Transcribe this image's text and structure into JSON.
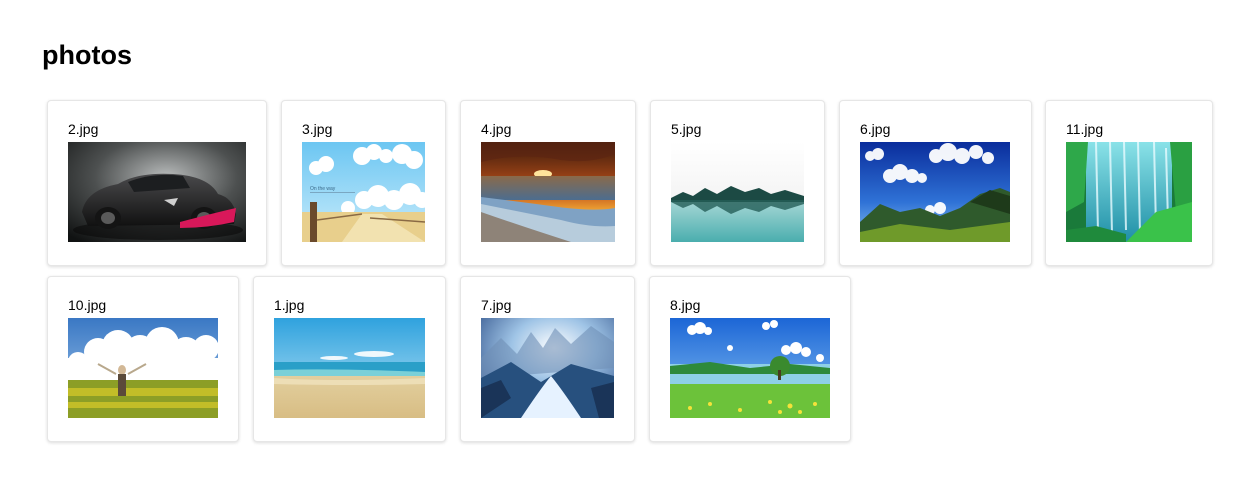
{
  "page": {
    "title": "photos"
  },
  "photos": [
    {
      "filename": "2.jpg",
      "subject": "black sports car"
    },
    {
      "filename": "3.jpg",
      "subject": "sky and wooden fence illustration",
      "caption_text": "On the way"
    },
    {
      "filename": "4.jpg",
      "subject": "sunset over beach"
    },
    {
      "filename": "5.jpg",
      "subject": "misty lake with tree reflection"
    },
    {
      "filename": "6.jpg",
      "subject": "blue sky over mountains"
    },
    {
      "filename": "11.jpg",
      "subject": "turquoise waterfall"
    },
    {
      "filename": "10.jpg",
      "subject": "person in flower field under clouds"
    },
    {
      "filename": "1.jpg",
      "subject": "sandy beach and sea"
    },
    {
      "filename": "7.jpg",
      "subject": "icy fantasy landscape"
    },
    {
      "filename": "8.jpg",
      "subject": "green meadow and lake"
    }
  ]
}
